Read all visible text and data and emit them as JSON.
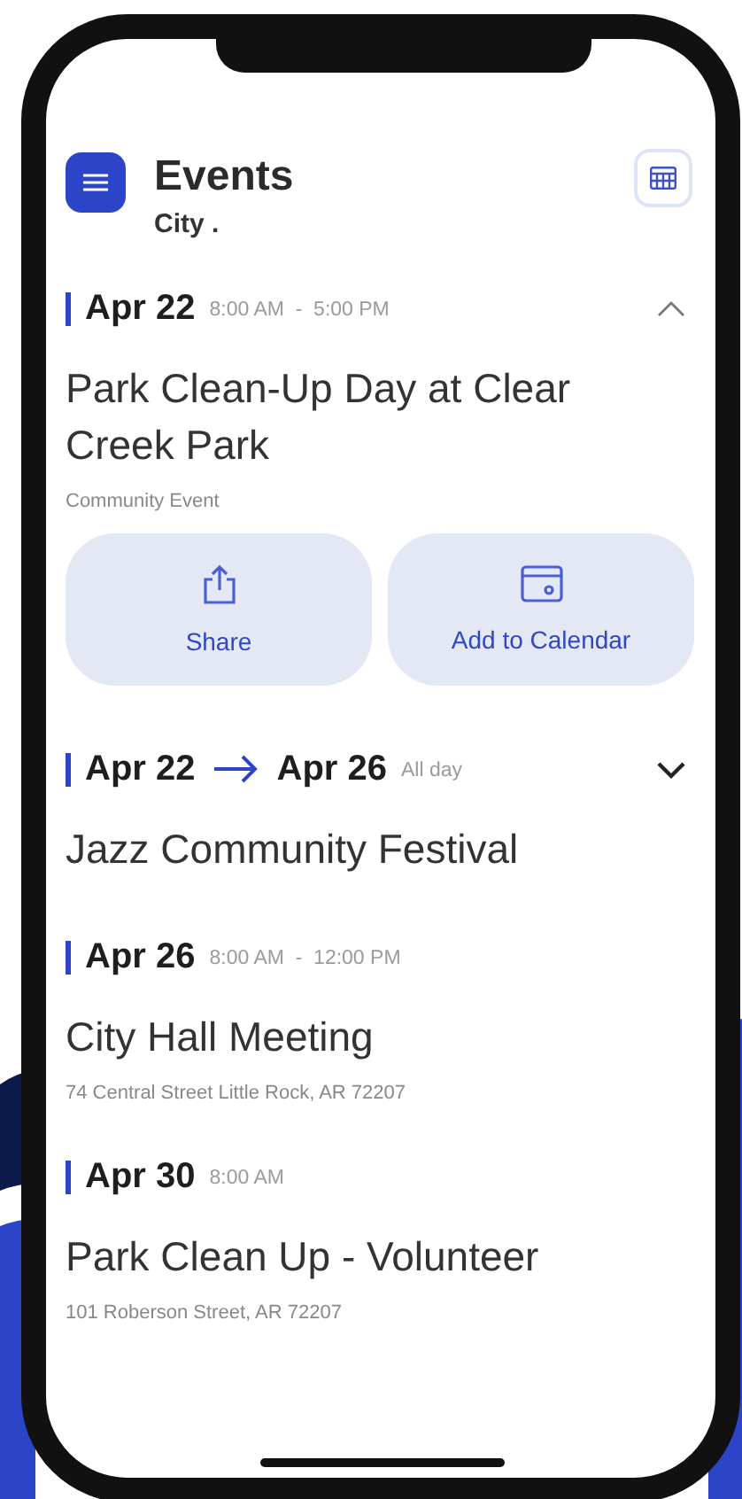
{
  "header": {
    "title": "Events",
    "subtitle": "City ."
  },
  "events": [
    {
      "kind": "collapsible",
      "expanded": true,
      "date": "Apr 22",
      "time": "8:00 AM  -  5:00 PM",
      "title": "Park Clean-Up Day at Clear Creek Park",
      "detail": "Community Event",
      "actions": [
        {
          "kind": "share",
          "label": "Share"
        },
        {
          "kind": "calendar",
          "label": "Add to Calendar"
        }
      ]
    },
    {
      "kind": "collapsible",
      "expanded": false,
      "date": "Apr 22",
      "date_end": "Apr 26",
      "time": "All day",
      "title": "Jazz Community Festival"
    },
    {
      "kind": "plain",
      "date": "Apr 26",
      "time": "8:00 AM  -  12:00 PM",
      "title": "City Hall Meeting",
      "detail": "74 Central Street Little Rock, AR 72207"
    },
    {
      "kind": "plain",
      "date": "Apr 30",
      "time": "8:00 AM",
      "title": "Park Clean Up - Volunteer",
      "detail": "101 Roberson Street, AR 72207"
    }
  ]
}
